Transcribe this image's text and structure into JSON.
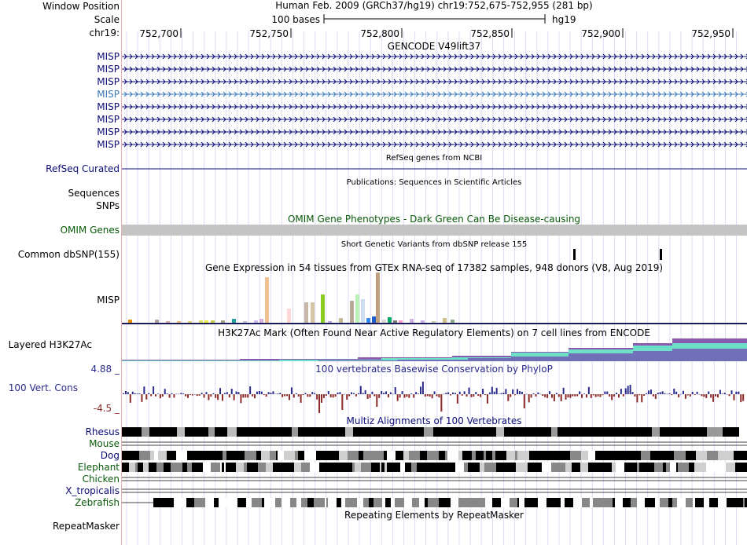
{
  "header": {
    "window_position_label": "Window Position",
    "scale_label": "Scale",
    "chrom_label": "chr19:",
    "assembly_title": "Human Feb. 2009 (GRCh37/hg19)   chr19:752,675-752,955 (281 bp)",
    "scale_text": "100 bases",
    "scale_db": "hg19",
    "ruler_ticks": [
      "752,700",
      "752,750",
      "752,800",
      "752,850",
      "752,900",
      "752,950"
    ]
  },
  "tracks": {
    "gencode": {
      "title": "GENCODE V49lift37",
      "labels": [
        "MISP",
        "MISP",
        "MISP",
        "MISP",
        "MISP",
        "MISP",
        "MISP",
        "MISP"
      ],
      "color": "#0c0c78",
      "highlight_color": "#3a78b8"
    },
    "refseq": {
      "title": "RefSeq genes from NCBI",
      "label": "RefSeq Curated",
      "color": "#0c0c78"
    },
    "publications": {
      "title": "Publications: Sequences in Scientific Articles",
      "label_1": "Sequences",
      "label_2": "SNPs"
    },
    "omim": {
      "title": "OMIM Gene Phenotypes - Dark Green Can Be Disease-causing",
      "label": "OMIM Genes",
      "color": "#0a5a0a"
    },
    "dbsnp": {
      "title": "Short Genetic Variants from dbSNP release 155",
      "label": "Common dbSNP(155)"
    },
    "gtex": {
      "title": "Gene Expression in 54 tissues from GTEx RNA-seq of 17382 samples, 948 donors (V8, Aug 2019)",
      "label": "MISP"
    },
    "h3k27ac": {
      "title": "H3K27Ac Mark (Often Found Near Active Regulatory Elements) on 7 cell lines from ENCODE",
      "label": "Layered H3K27Ac"
    },
    "phylop": {
      "title": "100 vertebrates Basewise Conservation by PhyloP",
      "label": "100 Vert. Cons",
      "max_label": "4.88 _",
      "min_label": "-4.5 _",
      "pos_color": "#2a2a8c",
      "neg_color": "#8c2a2a"
    },
    "multiz": {
      "title": "Multiz Alignments of 100 Vertebrates",
      "species": [
        "Rhesus",
        "Mouse",
        "Dog",
        "Elephant",
        "Chicken",
        "X_tropicalis",
        "Zebrafish"
      ]
    },
    "repeatmasker": {
      "title": "Repeating Elements by RepeatMasker",
      "label": "RepeatMasker"
    }
  }
}
